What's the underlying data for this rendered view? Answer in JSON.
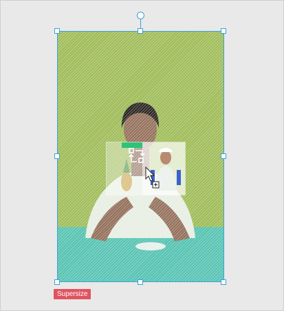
{
  "layout_badge": {
    "label": "Supersize",
    "color": "#e0545f"
  },
  "selection": {
    "accent": "#3aa1d6",
    "image": "woman-with-pineapple-photo"
  },
  "drag_preview": {
    "icon": "replace-image-icon",
    "thumbnail": "nurse-thumbnail"
  },
  "cursor": "move-copy-cursor"
}
